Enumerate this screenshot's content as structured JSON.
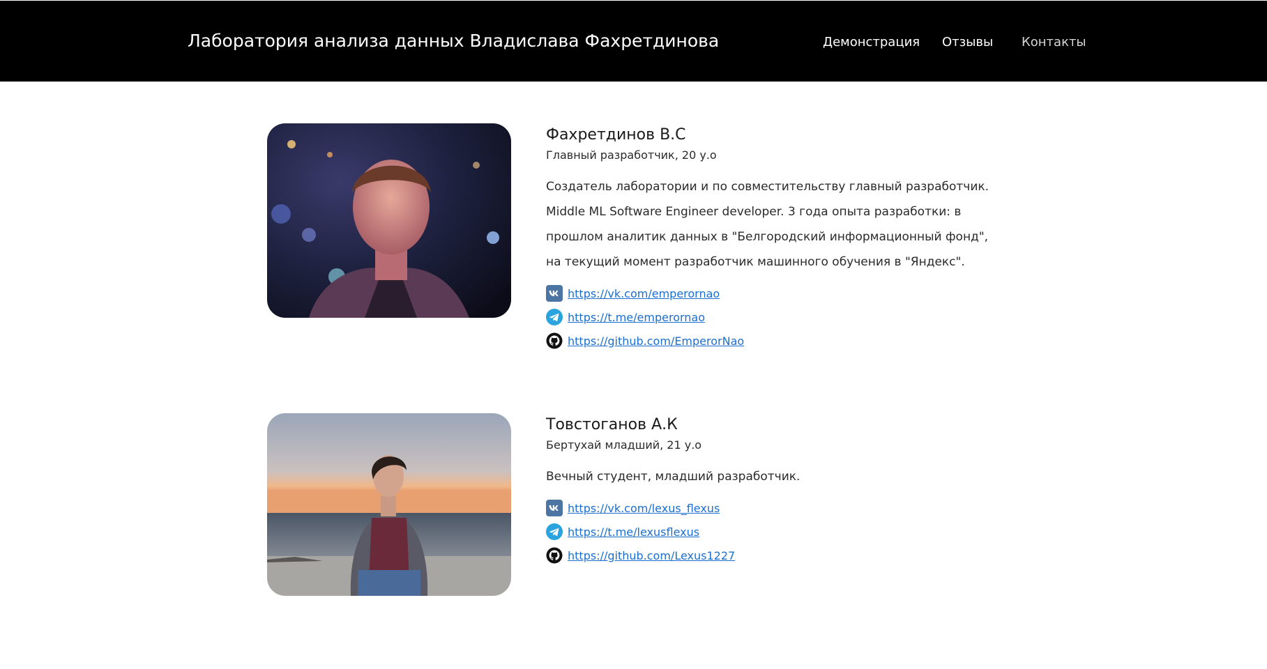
{
  "header": {
    "brand": "Лаборатория анализа данных Владислава Фахретдинова",
    "nav": [
      {
        "label": "Демонстрация"
      },
      {
        "label": "Отзывы"
      },
      {
        "label": "Контакты"
      }
    ]
  },
  "team": [
    {
      "name": "Фахретдинов В.С",
      "role": "Главный разработчик, 20 у.о",
      "bio": [
        "Создатель лаборатории и по совместительству главный разработчик.",
        "Middle ML Software Engineer developer. 3 года опыта разработки: в",
        "прошлом аналитик данных в \"Белгородский информационный фонд\",",
        "на текущий момент разработчик машинного обучения в \"Яндекс\"."
      ],
      "links": {
        "vk": "https://vk.com/emperornao",
        "telegram": "https://t.me/emperornao",
        "github": "https://github.com/EmperorNao"
      }
    },
    {
      "name": "Товстоганов А.К",
      "role": "Бертухай младший, 21 у.о",
      "bio": [
        "Вечный студент, младший разработчик."
      ],
      "links": {
        "vk": "https://vk.com/lexus_flexus",
        "telegram": "https://t.me/lexusflexus",
        "github": "https://github.com/Lexus1227"
      }
    }
  ],
  "icons": {
    "vk": "vk-icon",
    "telegram": "telegram-icon",
    "github": "github-icon"
  },
  "colors": {
    "header_bg": "#000000",
    "link": "#1a6fd0",
    "vk": "#4c75a3",
    "telegram": "#2aa3df"
  }
}
